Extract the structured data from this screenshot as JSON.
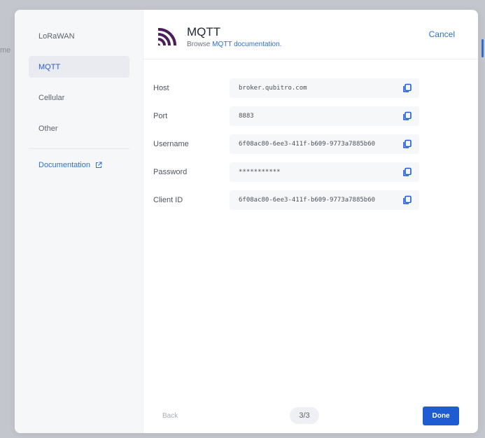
{
  "background": {
    "fragment_text": "me"
  },
  "sidebar": {
    "items": [
      {
        "label": "LoRaWAN",
        "active": false
      },
      {
        "label": "MQTT",
        "active": true
      },
      {
        "label": "Cellular",
        "active": false
      },
      {
        "label": "Other",
        "active": false
      }
    ],
    "documentation_label": "Documentation"
  },
  "header": {
    "title": "MQTT",
    "subtitle_prefix": "Browse",
    "subtitle_link": "MQTT documentation.",
    "cancel_label": "Cancel"
  },
  "fields": [
    {
      "label": "Host",
      "value": "broker.qubitro.com"
    },
    {
      "label": "Port",
      "value": "8883"
    },
    {
      "label": "Username",
      "value": "6f08ac80-6ee3-411f-b609-9773a7885b60"
    },
    {
      "label": "Password",
      "value": "***********"
    },
    {
      "label": "Client ID",
      "value": "6f08ac80-6ee3-411f-b609-9773a7885b60"
    }
  ],
  "footer": {
    "back_label": "Back",
    "page_indicator": "3/3",
    "done_label": "Done"
  },
  "colors": {
    "accent": "#1f5bd1",
    "link": "#2f6fd1",
    "logo": "#4a1e56"
  },
  "icons": {
    "logo": "mqtt-signal-logo",
    "copy": "copy-icon",
    "external": "external-link-icon"
  }
}
